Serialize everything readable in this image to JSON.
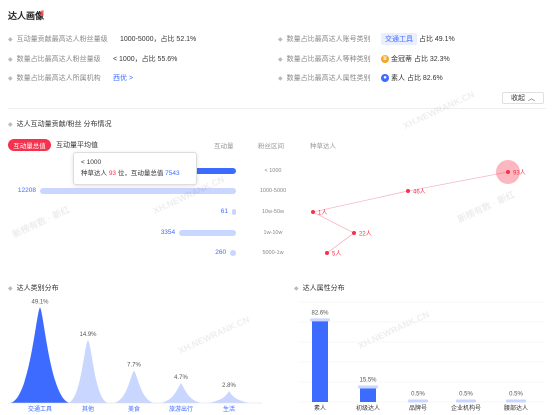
{
  "header": {
    "title": "达人画像",
    "title_mark": "///"
  },
  "stats": [
    {
      "label": "互动量贡献最高达人粉丝量级",
      "value": "1000-5000，占比 52.1%"
    },
    {
      "label": "数量占比最高达人粉丝量级",
      "value": "< 1000，占比 55.6%"
    },
    {
      "label": "数量占比最高达人所属机构",
      "value": "西优 >"
    },
    {
      "label": "数量占比最高达人账号类别",
      "tag": "交通工具",
      "value": "占比 49.1%"
    },
    {
      "label": "数量占比最高达人等种类别",
      "tag": "金冠蒂",
      "value": "占比 32.3%"
    },
    {
      "label": "数量占比最高达人属性类别",
      "tag": "素人",
      "value": "占比 82.6%"
    }
  ],
  "collapse_label": "收起",
  "interaction_section": {
    "title": "达人互动量贡献/粉丝 分布情况",
    "tab_active": "互动量总值",
    "tab_inactive": "互动量平均值",
    "col_interaction": "互动量",
    "col_range": "粉丝区间",
    "col_kol": "种草达人",
    "tooltip_line1": "< 1000",
    "tooltip_prefix": "种草达人",
    "tooltip_rank": "93",
    "tooltip_mid": "位，互动量总值",
    "tooltip_value": "7543",
    "rows": [
      {
        "range": "< 1000",
        "value": "7543",
        "fill": 0.61,
        "kol": "93人"
      },
      {
        "range": "1000-5000",
        "value": "12208",
        "fill": 1.0,
        "kol": "46人"
      },
      {
        "range": "10w-50w",
        "value": "61",
        "fill": 0.02,
        "kol": "1人"
      },
      {
        "range": "1w-10w",
        "value": "3354",
        "fill": 0.29,
        "kol": "22人"
      },
      {
        "range": "5000-1w",
        "value": "260",
        "fill": 0.03,
        "kol": "5人"
      }
    ]
  },
  "category_section": {
    "title": "达人类别分布",
    "chart_data": {
      "type": "area",
      "categories": [
        "交通工具",
        "其他",
        "美食",
        "旅游出行",
        "生活"
      ],
      "values": [
        49.1,
        14.9,
        7.7,
        4.7,
        2.8
      ],
      "value_labels": [
        "49.1%",
        "14.9%",
        "7.7%",
        "4.7%",
        "2.8%"
      ]
    }
  },
  "attribute_section": {
    "title": "达人属性分布",
    "chart_data": {
      "type": "bar",
      "categories": [
        "素人",
        "初级达人",
        "品牌号",
        "企业机构号",
        "腰部达人"
      ],
      "values": [
        82.6,
        15.5,
        0.5,
        0.5,
        0.5
      ],
      "value_labels": [
        "82.6%",
        "15.5%",
        "0.5%",
        "0.5%",
        "0.5%"
      ]
    }
  },
  "watermark": "XH.NEWRANK.CN",
  "watermark_cn": "新榜有数 · 新红",
  "colors": {
    "accent": "#3d6bff",
    "accent_light": "#c9d6ff",
    "red": "#f5314d"
  }
}
